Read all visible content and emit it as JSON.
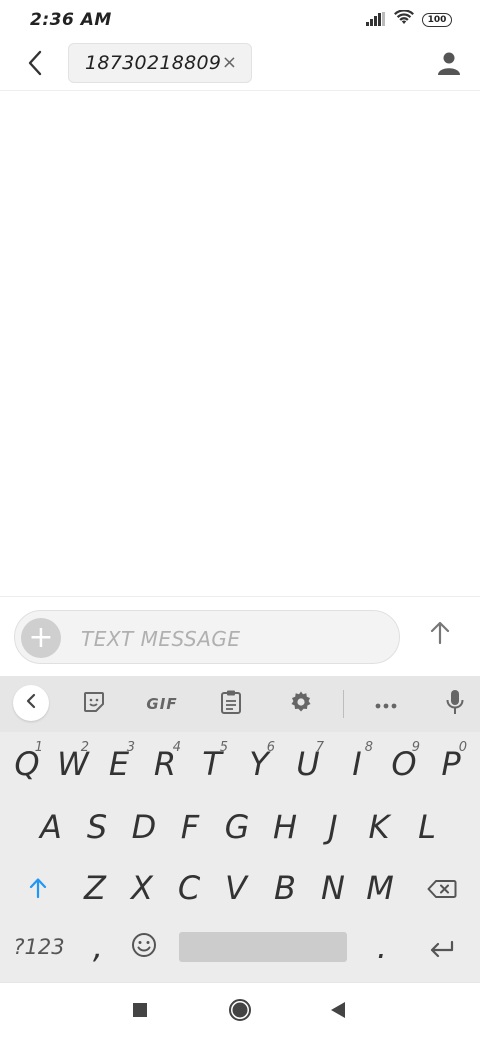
{
  "status_bar": {
    "time": "2:36 AM",
    "battery": "100"
  },
  "header": {
    "recipient": "18730218809",
    "chip_close": "×"
  },
  "compose": {
    "placeholder": "TEXT MESSAGE",
    "add_symbol": "+"
  },
  "keyboard": {
    "toolbar": {
      "gif_label": "GIF"
    },
    "row1": [
      {
        "key": "Q",
        "hint": "1"
      },
      {
        "key": "W",
        "hint": "2"
      },
      {
        "key": "E",
        "hint": "3"
      },
      {
        "key": "R",
        "hint": "4"
      },
      {
        "key": "T",
        "hint": "5"
      },
      {
        "key": "Y",
        "hint": "6"
      },
      {
        "key": "U",
        "hint": "7"
      },
      {
        "key": "I",
        "hint": "8"
      },
      {
        "key": "O",
        "hint": "9"
      },
      {
        "key": "P",
        "hint": "0"
      }
    ],
    "row2": [
      "A",
      "S",
      "D",
      "F",
      "G",
      "H",
      "J",
      "K",
      "L"
    ],
    "row3": [
      "Z",
      "X",
      "C",
      "V",
      "B",
      "N",
      "M"
    ],
    "symbols_label": "?123",
    "comma": ",",
    "period": "."
  },
  "colors": {
    "accent": "#2196f3"
  }
}
